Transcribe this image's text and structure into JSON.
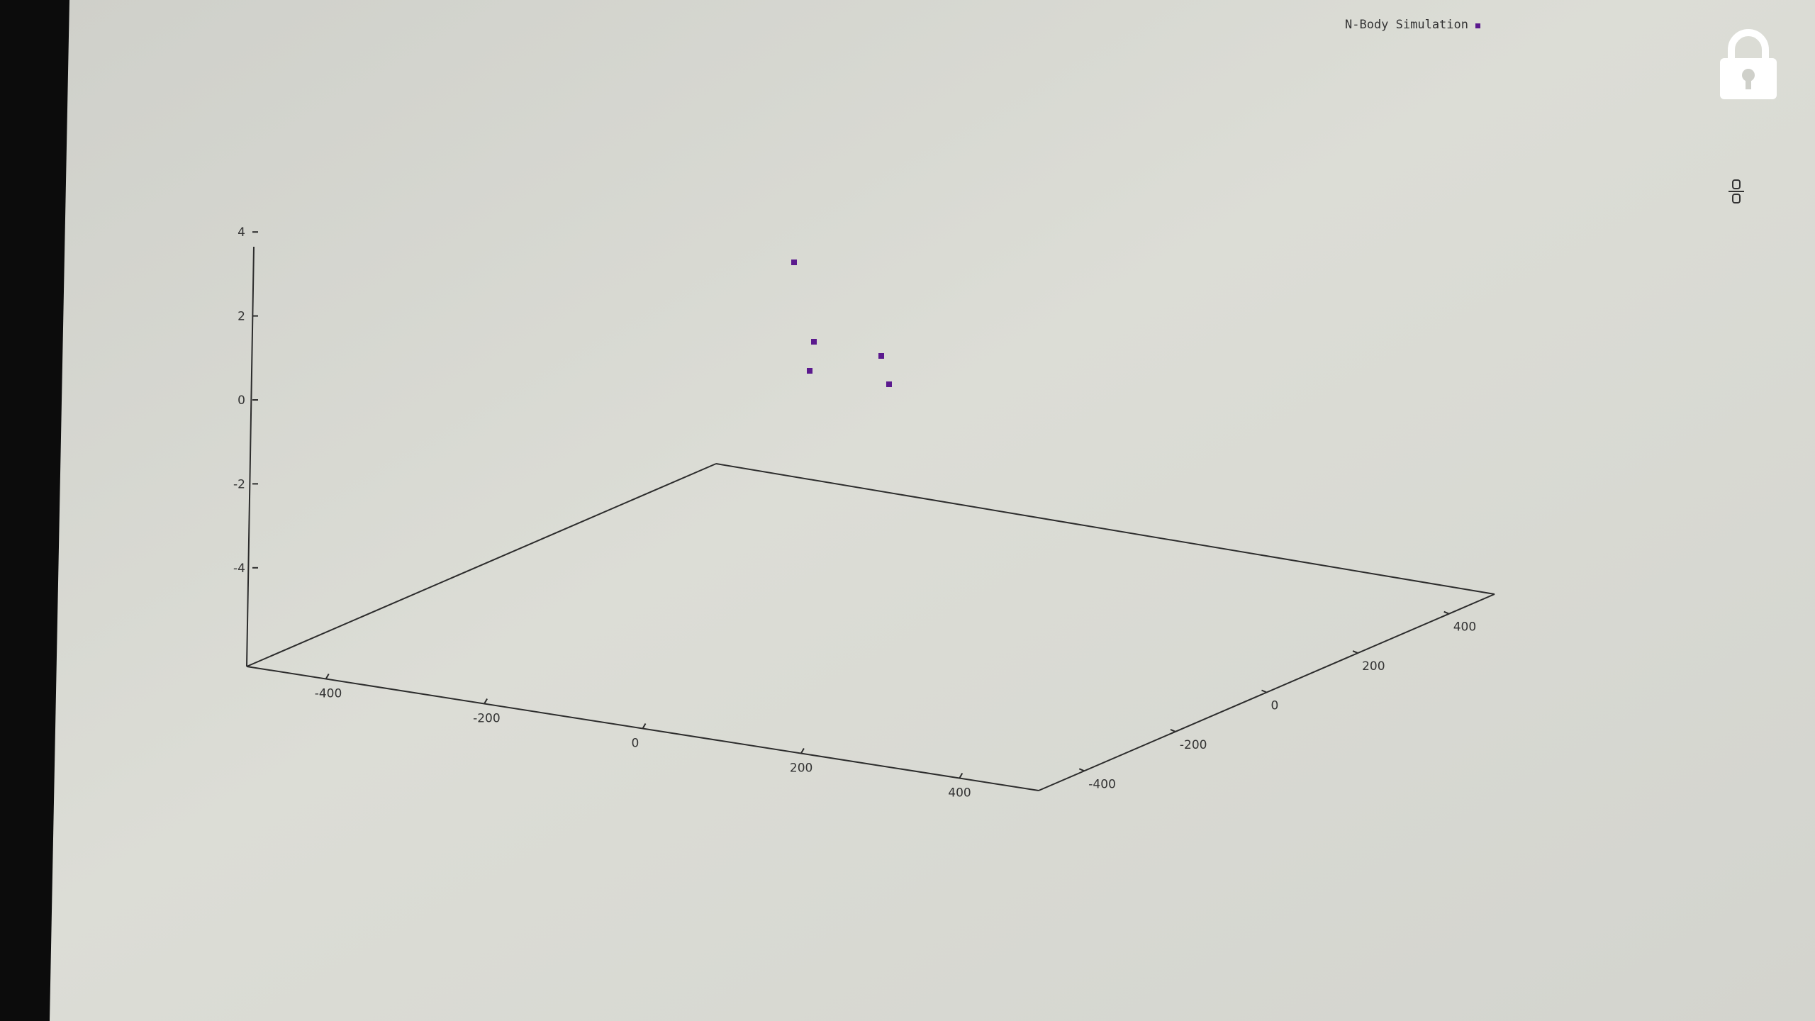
{
  "legend": {
    "label": "N-Body Simulation",
    "marker_color": "#5b1a8e"
  },
  "overlay": {
    "lock_icon": "lock-icon",
    "side_icon": "divide-icon"
  },
  "chart_data": {
    "type": "scatter",
    "projection": "3d",
    "title": "",
    "xlabel": "",
    "ylabel": "",
    "zlabel": "",
    "xlim": [
      -500,
      500
    ],
    "ylim": [
      -500,
      500
    ],
    "zlim": [
      -5,
      5
    ],
    "x_ticks": [
      -400,
      -200,
      0,
      200,
      400
    ],
    "y_ticks": [
      -400,
      -200,
      0,
      200,
      400
    ],
    "z_ticks": [
      4,
      2,
      0,
      -2,
      -4
    ],
    "grid": false,
    "legend_position": "top-right",
    "series": [
      {
        "name": "N-Body Simulation",
        "color": "#5b1a8e",
        "points": [
          {
            "x": -55,
            "y": 400,
            "z": 4.0
          },
          {
            "x": -45,
            "y": 430,
            "z": 1.5
          },
          {
            "x": -50,
            "y": 410,
            "z": 0.3
          },
          {
            "x": 40,
            "y": 430,
            "z": 1.0
          },
          {
            "x": 45,
            "y": 410,
            "z": -0.2
          }
        ]
      }
    ]
  }
}
